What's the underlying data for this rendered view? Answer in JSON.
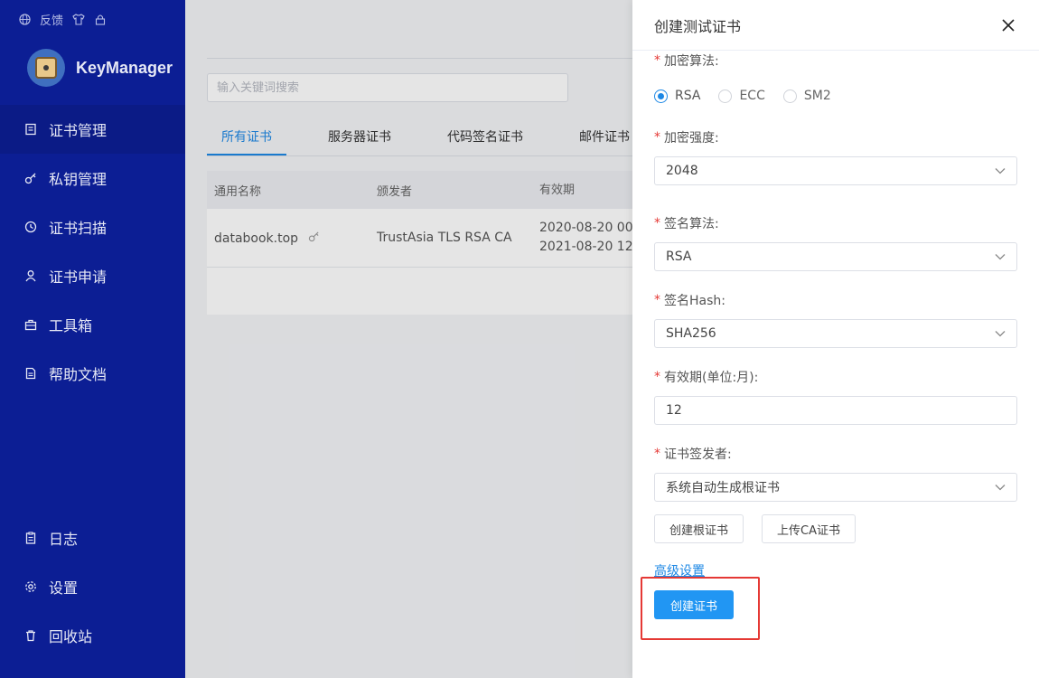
{
  "sidebar": {
    "top": {
      "feedback": "反馈"
    },
    "brand": "KeyManager",
    "nav": [
      {
        "label": "证书管理",
        "icon": "certificate-icon"
      },
      {
        "label": "私钥管理",
        "icon": "key-icon"
      },
      {
        "label": "证书扫描",
        "icon": "clock-icon"
      },
      {
        "label": "证书申请",
        "icon": "user-icon"
      },
      {
        "label": "工具箱",
        "icon": "toolbox-icon"
      },
      {
        "label": "帮助文档",
        "icon": "document-icon"
      }
    ],
    "bottom": [
      {
        "label": "日志",
        "icon": "clipboard-icon"
      },
      {
        "label": "设置",
        "icon": "gear-icon"
      },
      {
        "label": "回收站",
        "icon": "trash-icon"
      }
    ]
  },
  "main": {
    "search_placeholder": "输入关键词搜索",
    "tabs": [
      "所有证书",
      "服务器证书",
      "代码签名证书",
      "邮件证书"
    ],
    "table": {
      "headers": [
        "通用名称",
        "颁发者",
        "有效期"
      ],
      "row": {
        "name": "databook.top",
        "issuer": "TrustAsia TLS RSA CA",
        "valid_from": "2020-08-20 00:",
        "valid_to": "2021-08-20 12:"
      }
    }
  },
  "drawer": {
    "title": "创建测试证书",
    "algorithm": {
      "label": "加密算法:",
      "options": [
        "RSA",
        "ECC",
        "SM2"
      ],
      "selected": "RSA"
    },
    "strength": {
      "label": "加密强度:",
      "value": "2048"
    },
    "sign_algorithm": {
      "label": "签名算法:",
      "value": "RSA"
    },
    "sign_hash": {
      "label": "签名Hash:",
      "value": "SHA256"
    },
    "validity": {
      "label": "有效期(单位:月):",
      "value": "12"
    },
    "issuer": {
      "label": "证书签发者:",
      "value": "系统自动生成根证书"
    },
    "create_root_label": "创建根证书",
    "upload_ca_label": "上传CA证书",
    "advanced_label": "高级设置",
    "submit_label": "创建证书"
  },
  "colors": {
    "sidebar": "#0c1e94",
    "primary": "#2196f3",
    "highlight": "#e53935"
  }
}
